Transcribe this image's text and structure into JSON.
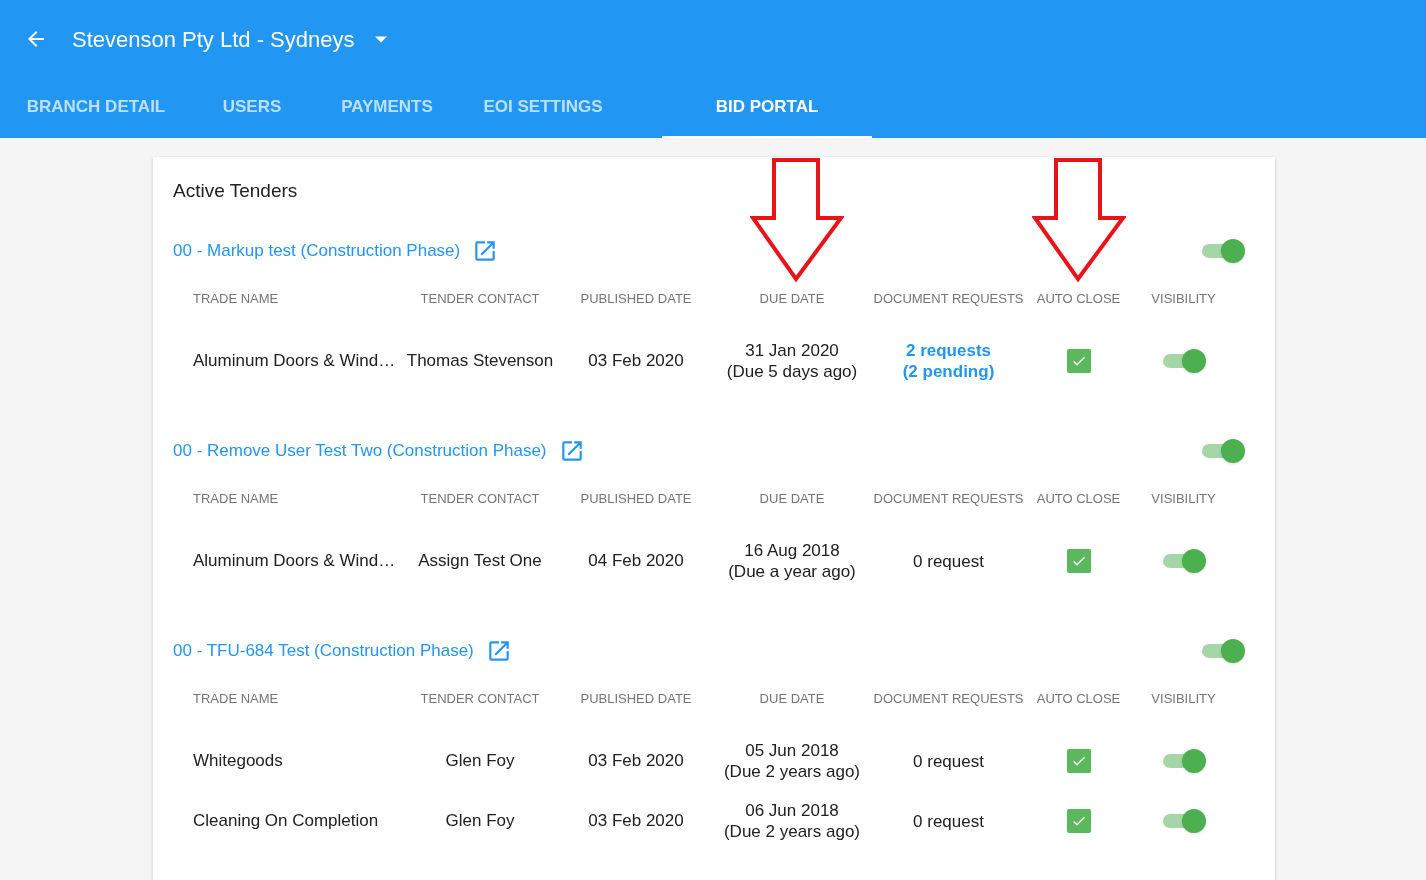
{
  "header": {
    "title": "Stevenson Pty Ltd - Sydneys"
  },
  "tabs": [
    {
      "label": "BRANCH DETAIL",
      "selected": false
    },
    {
      "label": "USERS",
      "selected": false
    },
    {
      "label": "PAYMENTS",
      "selected": false
    },
    {
      "label": "EOI SETTINGS",
      "selected": false
    },
    {
      "label": "BID PORTAL",
      "selected": true
    }
  ],
  "section_title": "Active Tenders",
  "tenders": [
    {
      "title": "00 - Markup test (Construction Phase)",
      "on": true,
      "columns": [
        "TRADE NAME",
        "TENDER CONTACT",
        "PUBLISHED DATE",
        "DUE DATE",
        "DOCUMENT REQUESTS",
        "AUTO CLOSE",
        "VISIBILITY"
      ],
      "rows": [
        {
          "trade_name": "Aluminum Doors & Wind…",
          "contact": "Thomas Stevenson",
          "published": "03 Feb 2020",
          "due_date": "31 Jan 2020",
          "due_note": "(Due 5 days ago)",
          "requests": {
            "kind": "link",
            "lines": [
              "2 requests",
              "(2 pending)"
            ]
          },
          "auto_close": true,
          "visible": true
        }
      ]
    },
    {
      "title": "00 - Remove User Test Two (Construction Phase)",
      "on": true,
      "columns": [
        "TRADE NAME",
        "TENDER CONTACT",
        "PUBLISHED DATE",
        "DUE DATE",
        "DOCUMENT REQUESTS",
        "AUTO CLOSE",
        "VISIBILITY"
      ],
      "rows": [
        {
          "trade_name": "Aluminum Doors & Wind…",
          "contact": "Assign Test One",
          "published": "04 Feb 2020",
          "due_date": "16 Aug 2018",
          "due_note": "(Due a year ago)",
          "requests": {
            "kind": "text",
            "lines": [
              "0 request"
            ]
          },
          "auto_close": true,
          "visible": true
        }
      ]
    },
    {
      "title": "00 - TFU-684 Test (Construction Phase)",
      "on": true,
      "columns": [
        "TRADE NAME",
        "TENDER CONTACT",
        "PUBLISHED DATE",
        "DUE DATE",
        "DOCUMENT REQUESTS",
        "AUTO CLOSE",
        "VISIBILITY"
      ],
      "rows": [
        {
          "trade_name": "Whitegoods",
          "contact": "Glen Foy",
          "published": "03 Feb 2020",
          "due_date": "05 Jun 2018",
          "due_note": "(Due 2 years ago)",
          "requests": {
            "kind": "text",
            "lines": [
              "0 request"
            ]
          },
          "auto_close": true,
          "visible": true
        },
        {
          "trade_name": "Cleaning On Completion",
          "contact": "Glen Foy",
          "published": "03 Feb 2020",
          "due_date": "06 Jun 2018",
          "due_note": "(Due 2 years ago)",
          "requests": {
            "kind": "text",
            "lines": [
              "0 request"
            ]
          },
          "auto_close": true,
          "visible": true
        }
      ]
    }
  ]
}
